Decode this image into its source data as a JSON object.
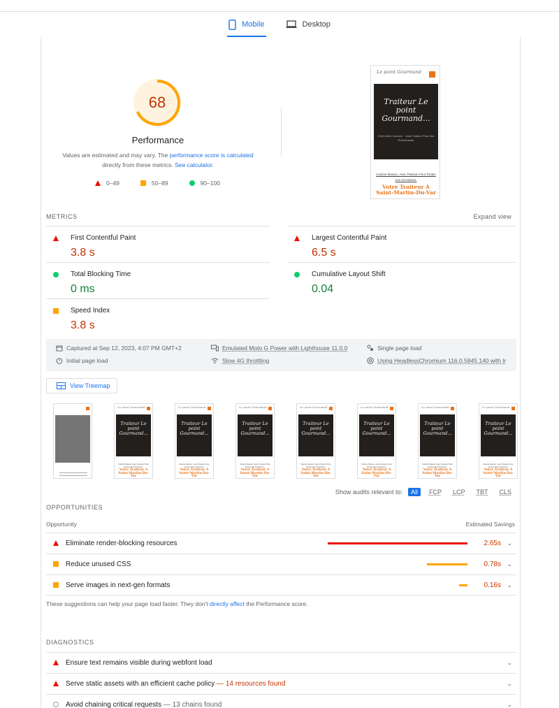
{
  "tabs": [
    {
      "label": "Mobile",
      "active": true
    },
    {
      "label": "Desktop",
      "active": false
    }
  ],
  "score": {
    "value": "68",
    "fraction": 0.68,
    "title": "Performance",
    "note_pre": "Values are estimated and may vary. The ",
    "note_link1": "performance score is calculated",
    "note_mid": " directly from these metrics. ",
    "note_link2": "See calculator.",
    "legend": [
      "0–49",
      "50–89",
      "90–100"
    ]
  },
  "preview": {
    "logo": "Le point Gourmand",
    "hero_title": "Traiteur Le point Gourmand...",
    "hero_sub": "Chef Julien Lorenzo · Votre Traiteur Pour Vos Événements",
    "sub": "Cuisine Maison, Avec Passion Pour Toutes Vos Occasions.",
    "big": "Votre Traiteur À Saint-Martin-Du-Var"
  },
  "metrics": {
    "label": "METRICS",
    "expand": "Expand view",
    "items": [
      {
        "name": "First Contentful Paint",
        "value": "3.8 s",
        "status": "fail"
      },
      {
        "name": "Largest Contentful Paint",
        "value": "6.5 s",
        "status": "fail"
      },
      {
        "name": "Total Blocking Time",
        "value": "0 ms",
        "status": "pass"
      },
      {
        "name": "Cumulative Layout Shift",
        "value": "0.04",
        "status": "pass"
      },
      {
        "name": "Speed Index",
        "value": "3.8 s",
        "status": "average"
      }
    ]
  },
  "info": {
    "captured": "Captured at Sep 12, 2023, 4:07 PM GMT+2",
    "initial": "Initial page load",
    "device": "Emulated Moto G Power with Lighthouse 11.0.0",
    "throttling": "Slow 4G throttling",
    "session": "Single page load",
    "browser": "Using HeadlessChromium 116.0.5845.140 with lr"
  },
  "treemap": {
    "label": "View Treemap"
  },
  "filmstrip": {
    "logo": "Le point Gourmand",
    "hero": "Traiteur Le point Gourmand...",
    "sub": "Cuisine Maison, Avec Passion Pour Toutes Vos Occasions.",
    "big": "Votre Traiteur À Saint-Martin-Du-Var"
  },
  "audits_filter": {
    "label": "Show audits relevant to:",
    "tags": [
      "All",
      "FCP",
      "LCP",
      "TBT",
      "CLS"
    ]
  },
  "opportunities": {
    "label": "OPPORTUNITIES",
    "col_left": "Opportunity",
    "col_right": "Estimated Savings",
    "items": [
      {
        "title": "Eliminate render-blocking resources",
        "savings": "2.65s",
        "status": "fail",
        "fraction": 1.0
      },
      {
        "title": "Reduce unused CSS",
        "savings": "0.78s",
        "status": "average",
        "fraction": 0.29
      },
      {
        "title": "Serve images in next-gen formats",
        "savings": "0.16s",
        "status": "average",
        "fraction": 0.06
      }
    ],
    "foot_pre": "These suggestions can help your page load faster. They don't ",
    "foot_link": "directly affect",
    "foot_post": " the Performance score."
  },
  "diagnostics": {
    "label": "DIAGNOSTICS",
    "items": [
      {
        "title": "Ensure text remains visible during webfont load",
        "extra": "",
        "status": "fail"
      },
      {
        "title": "Serve static assets with an efficient cache policy",
        "extra": " — 14 resources found",
        "status": "fail"
      },
      {
        "title": "Avoid chaining critical requests",
        "extra": " — 13 chains found",
        "status": "info"
      }
    ]
  },
  "colors": {
    "fail": "#eb0f00",
    "average": "#ffa400",
    "pass": "#0cce6b",
    "accent": "#1a73e8"
  }
}
